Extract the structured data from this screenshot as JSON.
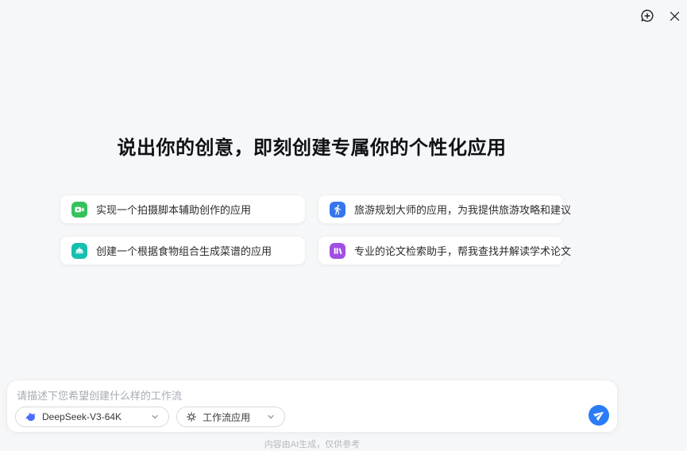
{
  "header": {
    "new_chat_icon": "bubble-plus-icon",
    "close_icon": "close-icon"
  },
  "main": {
    "title": "说出你的创意，即刻创建专属你的个性化应用",
    "suggestions": [
      {
        "label": "实现一个拍摄脚本辅助创作的应用",
        "icon": "video-camera-icon",
        "color": "#35c25d"
      },
      {
        "label": "旅游规划大师的应用，为我提供旅游攻略和建议",
        "icon": "walking-person-icon",
        "color": "#3575f0"
      },
      {
        "label": "创建一个根据食物组合生成菜谱的应用",
        "icon": "food-cloche-icon",
        "color": "#16bfb0"
      },
      {
        "label": "专业的论文检索助手，帮我查找并解读学术论文",
        "icon": "books-icon",
        "color": "#a14fe3"
      }
    ]
  },
  "composer": {
    "placeholder": "请描述下您希望创建什么样的工作流",
    "model_selector": {
      "value": "DeepSeek-V3-64K",
      "icon": "deepseek-whale-icon",
      "icon_color": "#4d6bfe"
    },
    "app_type_selector": {
      "value": "工作流应用",
      "icon": "gear-icon"
    },
    "send": {
      "icon": "paper-plane-icon",
      "color": "#2b7cf7"
    }
  },
  "footer": {
    "disclaimer": "内容由AI生成，仅供参考"
  }
}
